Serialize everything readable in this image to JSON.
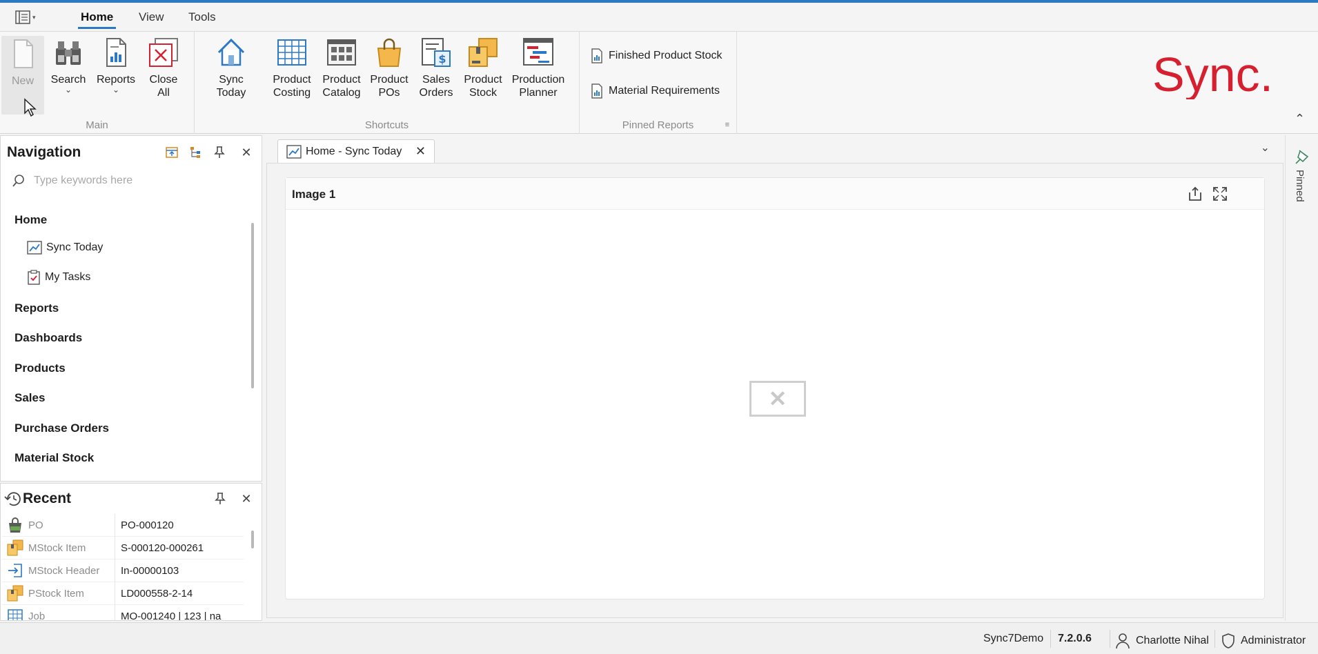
{
  "menu": {
    "tabs": [
      "Home",
      "View",
      "Tools"
    ],
    "active_tab": "Home"
  },
  "ribbon": {
    "groups": {
      "main": "Main",
      "shortcuts": "Shortcuts",
      "pinned_reports": "Pinned Reports"
    },
    "main_buttons": {
      "new": "New",
      "search": "Search",
      "reports": "Reports",
      "close_all_line1": "Close",
      "close_all_line2": "All"
    },
    "shortcuts": [
      {
        "line1": "Sync Today",
        "line2": ""
      },
      {
        "line1": "Product",
        "line2": "Costing"
      },
      {
        "line1": "Product",
        "line2": "Catalog"
      },
      {
        "line1": "Product",
        "line2": "POs"
      },
      {
        "line1": "Sales",
        "line2": "Orders"
      },
      {
        "line1": "Product",
        "line2": "Stock"
      },
      {
        "line1": "Production",
        "line2": "Planner"
      }
    ],
    "pinned_reports": [
      "Finished Product Stock",
      "Material Requirements"
    ],
    "brand": "Sync."
  },
  "navigation": {
    "title": "Navigation",
    "search_placeholder": "Type keywords here",
    "sections": {
      "home": "Home",
      "home_items": [
        "Sync Today",
        "My Tasks"
      ],
      "others": [
        "Reports",
        "Dashboards",
        "Products",
        "Sales",
        "Purchase Orders",
        "Material Stock"
      ]
    }
  },
  "recent": {
    "title": "Recent",
    "rows": [
      {
        "type": "PO",
        "value": "PO-000120",
        "icon": "bag-icon"
      },
      {
        "type": "MStock Item",
        "value": "S-000120-000261",
        "icon": "stock-box-icon"
      },
      {
        "type": "MStock Header",
        "value": "In-00000103",
        "icon": "stock-in-icon"
      },
      {
        "type": "PStock Item",
        "value": "LD000558-2-14",
        "icon": "stock-box-icon"
      },
      {
        "type": "Job",
        "value": "MO-001240 | 123 | na",
        "icon": "grid-icon"
      }
    ]
  },
  "document": {
    "tab_title": "Home - Sync Today",
    "card_title": "Image 1"
  },
  "pinned_bar": {
    "label": "Pinned"
  },
  "status": {
    "database": "Sync7Demo",
    "version": "7.2.0.6",
    "user": "Charlotte Nihal",
    "role": "Administrator"
  },
  "colors": {
    "accent": "#2b78c5",
    "brand_red": "#d6202f"
  }
}
